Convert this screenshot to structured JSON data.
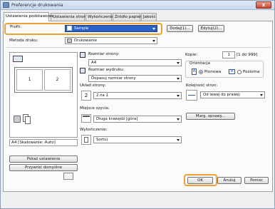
{
  "window": {
    "title": "Preferencje drukowania",
    "close_glyph": "x"
  },
  "tabs": [
    "Ustawienia podstawowe",
    "Ustawienia strony",
    "Wykończenie",
    "Źródło papieru",
    "Jakość"
  ],
  "profile": {
    "label": "Profil:",
    "value": "Sample",
    "add_button": "Dodaj(1)...",
    "edit_button": "Edytuj(2)..."
  },
  "print_method": {
    "label": "Metoda druku:",
    "value": "Drukowanie"
  },
  "preview": {
    "page1": "1",
    "page2": "2",
    "status": "A4 [Skalowanie: Auto]"
  },
  "left_buttons": {
    "show_settings": "Pokaż ustawienia",
    "restore_defaults": "Przywróć domyślne"
  },
  "page_size": {
    "label": "Rozmiar strony:",
    "value": "A4"
  },
  "output_size": {
    "label": "Rozmiar wydruku:",
    "value": "Dopasuj rozmiar strony"
  },
  "copies": {
    "label": "Kopie:",
    "value": "1",
    "range": "[1 do 999]"
  },
  "orientation": {
    "label": "Orientacja",
    "portrait": "Pionowa",
    "landscape": "Pozioma",
    "portrait_glyph": "A",
    "landscape_glyph": "A",
    "selected": "portrait"
  },
  "layout": {
    "label": "Układ strony:",
    "value": "2 na 1",
    "icon_text": "2"
  },
  "page_order": {
    "label": "Kolejność stron:",
    "value": "Od lewej do prawej"
  },
  "margin_button": "Marg. oprawy...",
  "binding": {
    "label": "Miejsce szycia:",
    "value": "Długa krawędź [góra]"
  },
  "finishing": {
    "label": "Wykończenie:",
    "value": "Sortuj"
  },
  "footer": {
    "ok": "OK",
    "cancel": "Anuluj",
    "help": "Pomoc"
  },
  "colors": {
    "highlight": "#f0a030",
    "selection": "#2a62c9",
    "tab_active": "#fbfbfb"
  }
}
